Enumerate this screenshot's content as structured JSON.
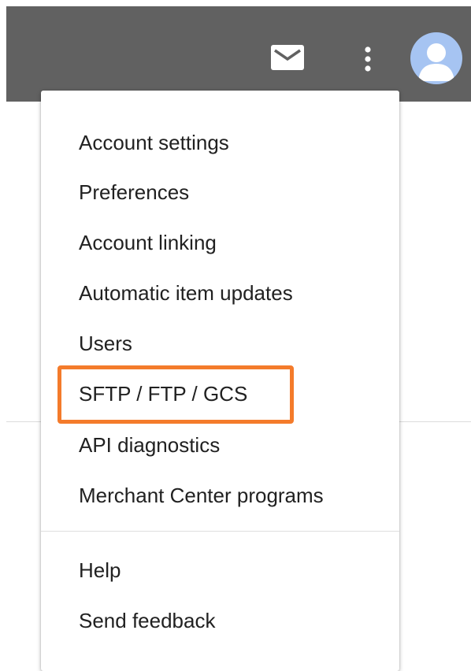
{
  "header": {
    "background_color": "#616161",
    "icons": {
      "mail": "mail-icon",
      "more": "more-vert-icon",
      "avatar": "account-avatar-icon"
    }
  },
  "menu": {
    "items": [
      {
        "label": "Account settings"
      },
      {
        "label": "Preferences"
      },
      {
        "label": "Account linking"
      },
      {
        "label": "Automatic item updates"
      },
      {
        "label": "Users"
      },
      {
        "label": "SFTP / FTP / GCS",
        "highlighted": true
      },
      {
        "label": "API diagnostics"
      },
      {
        "label": "Merchant Center programs"
      }
    ],
    "secondary_items": [
      {
        "label": "Help"
      },
      {
        "label": "Send feedback"
      }
    ]
  },
  "highlight_color": "#f47b2b"
}
